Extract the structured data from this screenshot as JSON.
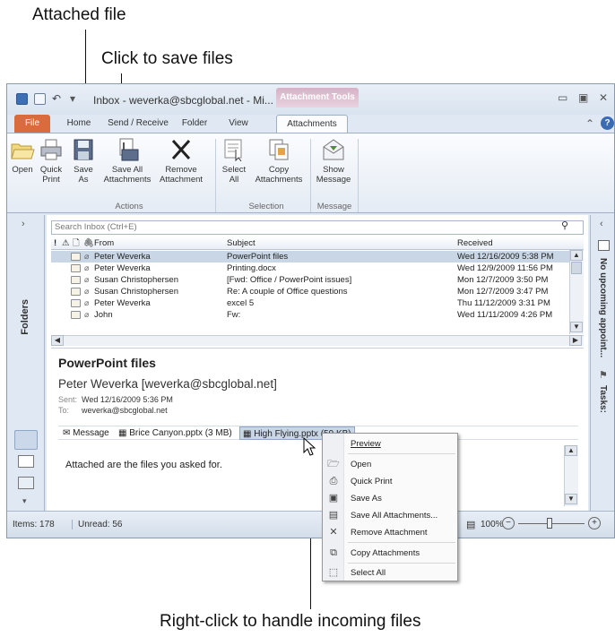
{
  "callouts": {
    "attached_file": "Attached file",
    "click_to_save": "Click to save files",
    "right_click": "Right-click to handle incoming files"
  },
  "window": {
    "title": "Inbox - weverka@sbcglobal.net - Mi...",
    "context_tab": "Attachment Tools"
  },
  "tabs": [
    "File",
    "Home",
    "Send / Receive",
    "Folder",
    "View",
    "Attachments"
  ],
  "ribbon": {
    "open": "Open",
    "quick_print": [
      "Quick",
      "Print"
    ],
    "save_as": [
      "Save",
      "As"
    ],
    "save_all": [
      "Save All",
      "Attachments"
    ],
    "remove": [
      "Remove",
      "Attachment"
    ],
    "select_all": [
      "Select",
      "All"
    ],
    "copy": [
      "Copy",
      "Attachments"
    ],
    "show": [
      "Show",
      "Message"
    ],
    "groups": {
      "actions": "Actions",
      "selection": "Selection",
      "message": "Message"
    }
  },
  "search": {
    "placeholder": "Search Inbox (Ctrl+E)"
  },
  "columns": {
    "from": "From",
    "subject": "Subject",
    "received": "Received"
  },
  "messages": [
    {
      "from": "Peter Weverka",
      "subject": "PowerPoint files",
      "received": "Wed 12/16/2009 5:38 PM",
      "selected": true
    },
    {
      "from": "Peter Weverka",
      "subject": "Printing.docx",
      "received": "Wed 12/9/2009 11:56 PM",
      "selected": false
    },
    {
      "from": "Susan Christophersen",
      "subject": "[Fwd: Office / PowerPoint issues]",
      "received": "Mon 12/7/2009 3:50 PM",
      "selected": false
    },
    {
      "from": "Susan Christophersen",
      "subject": "Re: A couple of Office questions",
      "received": "Mon 12/7/2009 3:47 PM",
      "selected": false
    },
    {
      "from": "Peter Weverka",
      "subject": "excel 5",
      "received": "Thu 11/12/2009 3:31 PM",
      "selected": false
    },
    {
      "from": "John",
      "subject": "Fw:",
      "received": "Wed 11/11/2009 4:26 PM",
      "selected": false
    }
  ],
  "nav": {
    "folders": "Folders"
  },
  "rightbar": {
    "appointments": "No upcoming appoint...",
    "tasks": "Tasks:"
  },
  "reading": {
    "subject": "PowerPoint files",
    "from": "Peter Weverka [weverka@sbcglobal.net]",
    "sent_label": "Sent:",
    "sent": "Wed 12/16/2009 5:36 PM",
    "to_label": "To:",
    "to": "weverka@sbcglobal.net",
    "attachments": [
      "Message",
      "Brice Canyon.pptx (3 MB)",
      "High Flying.pptx (59 KB)"
    ],
    "body": "Attached are the files you asked for."
  },
  "status": {
    "items": "Items: 178",
    "unread": "Unread: 56",
    "zoom": "100%"
  },
  "context_menu": [
    "Preview",
    "Open",
    "Quick Print",
    "Save As",
    "Save All Attachments...",
    "Remove Attachment",
    "Copy Attachments",
    "Select All"
  ]
}
